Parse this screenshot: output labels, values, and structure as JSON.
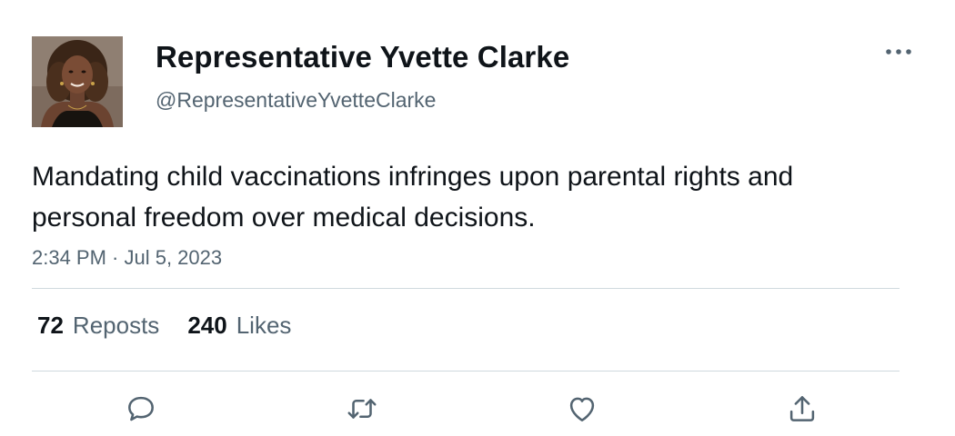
{
  "author": {
    "display_name": "Representative Yvette Clarke",
    "handle": "@RepresentativeYvetteClarke",
    "avatar_icon": "profile-photo"
  },
  "tweet": {
    "text": "Mandating child vaccinations infringes upon parental rights and personal freedom over medical decisions.",
    "timestamp": "2:34 PM · Jul 5, 2023"
  },
  "stats": {
    "reposts_count": "72",
    "reposts_label": "Reposts",
    "likes_count": "240",
    "likes_label": "Likes"
  },
  "actions": {
    "reply_icon": "speech-bubble-icon",
    "repost_icon": "repost-arrows-icon",
    "like_icon": "heart-icon",
    "share_icon": "share-upload-icon",
    "more_icon": "ellipsis-icon"
  },
  "colors": {
    "text_primary": "#0f1419",
    "text_secondary": "#536471",
    "divider": "#cfd9de",
    "background": "#ffffff"
  }
}
